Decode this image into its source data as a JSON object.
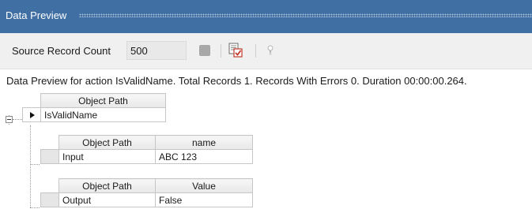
{
  "panel": {
    "title": "Data Preview"
  },
  "toolbar": {
    "source_label": "Source Record Count",
    "source_count": "500",
    "icons": [
      "stop-icon",
      "validate-icon",
      "lightbulb-icon"
    ]
  },
  "status": "Data Preview for action IsValidName. Total Records 1. Records With Errors 0. Duration 00:00:00.264.",
  "top_grid": {
    "header": "Object Path",
    "row": "IsValidName"
  },
  "input_grid": {
    "headers": [
      "Object Path",
      "name"
    ],
    "row": [
      "Input",
      "ABC 123"
    ]
  },
  "output_grid": {
    "headers": [
      "Object Path",
      "Value"
    ],
    "row": [
      "Output",
      "False"
    ]
  },
  "colors": {
    "title_bar": "#3f6fa3",
    "toolbar": "#f0f0f0",
    "header": "#eeeeee"
  }
}
